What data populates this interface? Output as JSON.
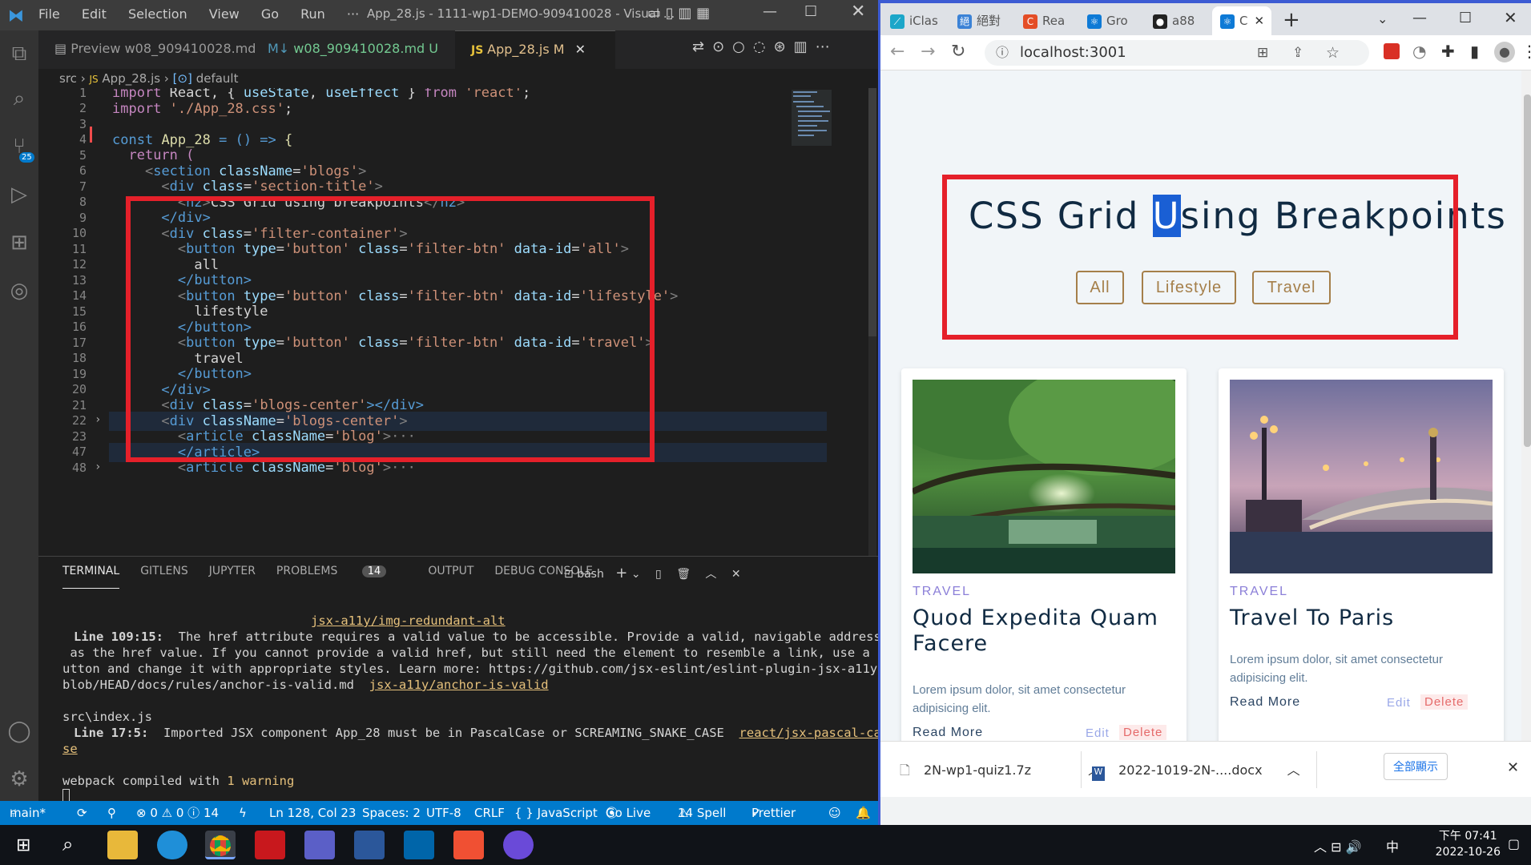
{
  "vscode": {
    "menu": [
      "File",
      "Edit",
      "Selection",
      "View",
      "Go",
      "Run",
      "···"
    ],
    "window_title": "App_28.js - 1111-wp1-DEMO-909410028 - Visual ...",
    "tabs": [
      {
        "label": "Preview w08_909410028.md",
        "icon": "preview-icon"
      },
      {
        "label": "w08_909410028.md",
        "suffix": "U",
        "icon": "markdown-icon"
      },
      {
        "label": "App_28.js",
        "suffix": "M",
        "icon": "js-icon",
        "active": true
      }
    ],
    "breadcrumb": {
      "folder": "src",
      "file": "App_28.js",
      "symbol": "default"
    },
    "activity_badge": "25",
    "code_lines": [
      "1",
      "2",
      "3",
      "4",
      "5",
      "6",
      "7",
      "8",
      "9",
      "10",
      "11",
      "12",
      "13",
      "14",
      "15",
      "16",
      "17",
      "18",
      "19",
      "20",
      "21",
      "22",
      "23",
      "47",
      "48"
    ],
    "code": {
      "l1_a": "import",
      "l1_b": "React, {",
      "l1_c": "useState",
      "l1_d": ",",
      "l1_e": "useEffect",
      "l1_f": "}",
      "l1_g": "from",
      "l1_h": "'react'",
      "l1_i": ";",
      "l2_a": "import",
      "l2_b": "'./App_28.css'",
      "l2_c": ";",
      "l4_a": "const",
      "l4_b": "App_28",
      "l4_c": "= () =>",
      "l4_d": "{",
      "l5_a": "return",
      "l5_b": "(",
      "l6_a": "<",
      "l6_b": "section",
      "l6_c": "className",
      "l6_d": "=",
      "l6_e": "'blogs'",
      "l6_f": ">",
      "l7_a": "<",
      "l7_b": "div",
      "l7_c": "class",
      "l7_d": "=",
      "l7_e": "'section-title'",
      "l7_f": ">",
      "l8_a": "<",
      "l8_b": "h2",
      "l8_c": ">",
      "l8_d": "CSS Grid using breakpoints",
      "l8_e": "</",
      "l8_f": "h2",
      "l8_g": ">",
      "l9": "</div>",
      "l10_a": "<",
      "l10_b": "div",
      "l10_c": "class",
      "l10_d": "=",
      "l10_e": "'filter-container'",
      "l10_f": ">",
      "l11_e": "'all'",
      "l12": "all",
      "l14_e": "'lifestyle'",
      "l15": "lifestyle",
      "l17_e": "'travel'",
      "l18": "travel",
      "btn_type": "type",
      "btn_button": "'button'",
      "btn_class": "class",
      "btn_fclass": "'filter-btn'",
      "btn_dataid": "data-id",
      "btn_tag": "button",
      "eq": "=",
      "lt": "<",
      "gt": ">",
      "close_button": "</button>",
      "l20": "</div>",
      "l21_e": "'blogs-center'",
      "l21_f": "></div>",
      "l22_c": "className",
      "l22_e": "'blogs-center'",
      "l23_b": "article",
      "l23_e": "'blog'",
      "l23_g": "···",
      "l47": "</article>"
    },
    "panel_tabs": [
      "TERMINAL",
      "GITLENS",
      "JUPYTER",
      "PROBLEMS",
      "OUTPUT",
      "DEBUG CONSOLE"
    ],
    "problems_count": "14",
    "shell": "bash",
    "terminal": {
      "link1": "jsx-a11y/img-redundant-alt",
      "line_ref1": "Line 109:15:",
      "msg1_a": "  The href attribute requires a valid value to be accessible. Provide a valid, navigable address",
      "msg1_b": " as the href value. If you cannot provide a valid href, but still need the element to resemble a link, use a b",
      "msg1_c": "utton and change it with appropriate styles. Learn more: https://github.com/jsx-eslint/eslint-plugin-jsx-a11y/",
      "msg1_d": "blob/HEAD/docs/rules/anchor-is-valid.md  ",
      "link2": "jsx-a11y/anchor-is-valid",
      "file2": "src\\index.js",
      "line_ref2": "Line 17:5:",
      "msg2": "  Imported JSX component App_28 must be in PascalCase or SCREAMING_SNAKE_CASE  ",
      "link3a": "react/jsx-pascal-ca",
      "link3b": "se",
      "compiled_a": "webpack compiled with ",
      "compiled_b": "1 warning"
    },
    "status": {
      "branch": "main*",
      "errors": "⊗ 0 ⚠ 0 ⓘ 14",
      "position": "Ln 128, Col 23",
      "spaces": "Spaces: 2",
      "encoding": "UTF-8",
      "eol": "CRLF",
      "language": "{ } JavaScript",
      "golive": "Go Live",
      "spell": "14 Spell",
      "prettier": "Prettier"
    }
  },
  "chrome": {
    "tabs": [
      "iClas",
      "絕對",
      "Rea",
      "Gro",
      "a88",
      "C"
    ],
    "url": "localhost:3001",
    "page": {
      "title_a": "CSS Grid ",
      "title_sel": "U",
      "title_b": "sing Breakpoints",
      "filters": [
        "All",
        "Lifestyle",
        "Travel"
      ],
      "cards": [
        {
          "category": "TRAVEL",
          "title": "Quod Expedita Quam Facere",
          "text": "Lorem ipsum dolor, sit amet consectetur adipisicing elit.",
          "read": "Read More",
          "edit": "Edit",
          "delete": "Delete"
        },
        {
          "category": "TRAVEL",
          "title": "Travel To Paris",
          "text": "Lorem ipsum dolor, sit amet consectetur adipisicing elit.",
          "read": "Read More",
          "edit": "Edit",
          "delete": "Delete"
        }
      ]
    },
    "downloads": [
      {
        "name": "2N-wp1-quiz1.7z"
      },
      {
        "name": "2022-1019-2N-....docx"
      }
    ],
    "show_all": "全部顯示"
  },
  "taskbar": {
    "time": "下午 07:41",
    "date": "2022-10-26",
    "ime": "中"
  },
  "colors": {
    "accent_red": "#e5202a",
    "vscode_blue": "#007acc",
    "filter_btn": "#a57f4a",
    "heading": "#102a42"
  }
}
